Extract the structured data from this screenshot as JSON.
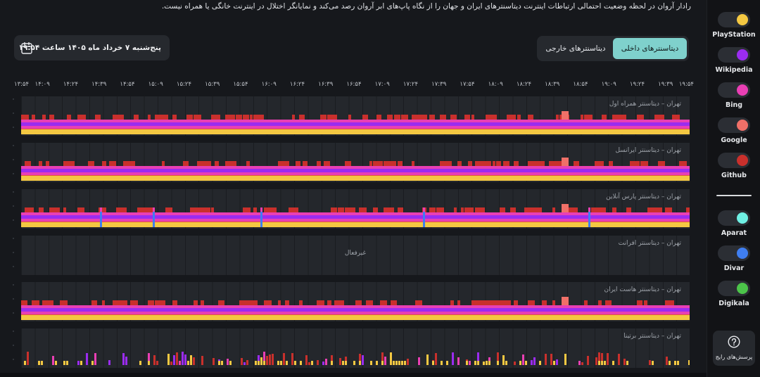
{
  "intro_text": "رادار آروان در لحظه وضعیت احتمالی ارتباطات اینترنت دیتاسنترهای ایران و جهان را از نگاه پاپ‌های ابر آروان رصد می‌کند و نمایانگر اختلال در اینترنت خانگی یا همراه نیست.",
  "tabs": {
    "domestic": "دیتاسنترهای داخلی",
    "foreign": "دیتاسنترهای خارجی"
  },
  "date_text": "پنج‌شنبه ۷ خرداد ماه ۱۴۰۵ ساعت ۱۹:۵۴",
  "time_ticks": [
    "۱۳:۵۴",
    "۱۴:۰۹",
    "۱۴:۲۴",
    "۱۴:۳۹",
    "۱۴:۵۴",
    "۱۵:۰۹",
    "۱۵:۲۴",
    "۱۵:۳۹",
    "۱۵:۵۴",
    "۱۶:۰۹",
    "۱۶:۲۴",
    "۱۶:۳۹",
    "۱۶:۵۴",
    "۱۷:۰۹",
    "۱۷:۲۴",
    "۱۷:۳۹",
    "۱۷:۵۴",
    "۱۸:۰۹",
    "۱۸:۲۴",
    "۱۸:۳۹",
    "۱۸:۵۴",
    "۱۹:۰۹",
    "۱۹:۲۴",
    "۱۹:۳۹",
    "۱۹:۵۴"
  ],
  "datacenters": [
    {
      "label": "تهران – دیتاسنتر همراه اول",
      "status": "active"
    },
    {
      "label": "تهران – دیتاسنتر ایرانسل",
      "status": "active"
    },
    {
      "label": "تهران – دیتاسنتر پارس آنلاین",
      "status": "active"
    },
    {
      "label": "تهران – دیتاسنتر افرانت",
      "status": "inactive",
      "inactive_text": "غیرفعال"
    },
    {
      "label": "تهران – دیتاسنتر هاست ایران",
      "status": "active"
    },
    {
      "label": "تهران – دیتاسنتر برتینا",
      "status": "active"
    }
  ],
  "services": [
    {
      "name": "PlayStation",
      "color": "#f4c842",
      "icon": "playstation-icon"
    },
    {
      "name": "Wikipedia",
      "color": "#9b2cf0",
      "icon": "wikipedia-icon"
    },
    {
      "name": "Bing",
      "color": "#e93fb4",
      "icon": "bing-icon"
    },
    {
      "name": "Google",
      "color": "#f07068",
      "icon": "google-icon"
    },
    {
      "name": "Github",
      "color": "#c9302c",
      "icon": "github-icon"
    },
    {
      "name": "Aparat",
      "color": "#6ff0e4",
      "icon": "aparat-icon"
    },
    {
      "name": "Divar",
      "color": "#3f7ef0",
      "icon": "divar-icon"
    },
    {
      "name": "Digikala",
      "color": "#4cc44a",
      "icon": "digikala-icon"
    }
  ],
  "faq_label": "پرسش‌های رایج"
}
